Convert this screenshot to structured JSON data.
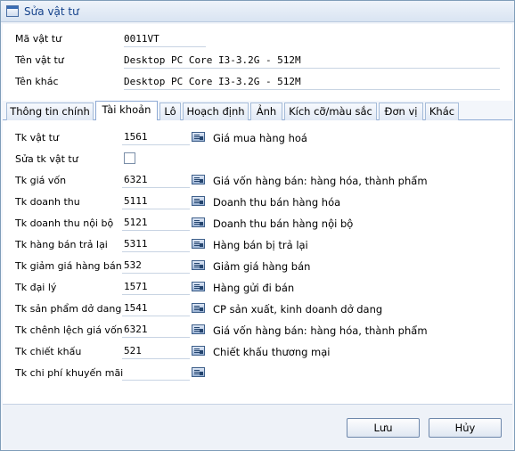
{
  "window": {
    "title": "Sửa vật tư"
  },
  "header": {
    "fields": [
      {
        "label": "Mã vật tư",
        "value": "0011VT"
      },
      {
        "label": "Tên vật tư",
        "value": "Desktop PC Core I3-3.2G - 512M"
      },
      {
        "label": "Tên khác",
        "value": "Desktop PC Core I3-3.2G - 512M"
      }
    ]
  },
  "tabs": [
    {
      "label": "Thông tin chính"
    },
    {
      "label": "Tài khoản",
      "active": true
    },
    {
      "label": "Lô"
    },
    {
      "label": "Hoạch định"
    },
    {
      "label": "Ảnh"
    },
    {
      "label": "Kích cỡ/màu sắc"
    },
    {
      "label": "Đơn vị"
    },
    {
      "label": "Khác"
    }
  ],
  "accounts": {
    "rows": [
      {
        "label": "Tk vật tư",
        "code": "1561",
        "desc": "Giá mua hàng hoá"
      },
      {
        "label": "Sửa tk vật tư",
        "checkbox": false
      },
      {
        "label": "Tk giá vốn",
        "code": "6321",
        "desc": "Giá vốn hàng bán: hàng hóa, thành phẩm"
      },
      {
        "label": "Tk doanh thu",
        "code": "5111",
        "desc": "Doanh thu bán hàng hóa"
      },
      {
        "label": "Tk doanh thu nội bộ",
        "code": "5121",
        "desc": "Doanh thu bán hàng nội bộ"
      },
      {
        "label": "Tk hàng bán trả lại",
        "code": "5311",
        "desc": "Hàng bán bị trả lại"
      },
      {
        "label": "Tk giảm giá hàng bán",
        "code": "532",
        "desc": "Giảm giá hàng bán"
      },
      {
        "label": "Tk đại lý",
        "code": "1571",
        "desc": "Hàng gửi đi bán"
      },
      {
        "label": "Tk sản phẩm dở dang",
        "code": "1541",
        "desc": "CP sản xuất, kinh doanh dở dang"
      },
      {
        "label": "Tk chênh lệch giá vốn",
        "code": "6321",
        "desc": "Giá vốn hàng bán: hàng hóa, thành phẩm"
      },
      {
        "label": "Tk chiết khấu",
        "code": "521",
        "desc": "Chiết khấu thương mại"
      },
      {
        "label": "Tk chi phí khuyến mãi",
        "code": "",
        "desc": ""
      }
    ]
  },
  "footer": {
    "save_label": "Lưu",
    "cancel_label": "Hủy"
  }
}
